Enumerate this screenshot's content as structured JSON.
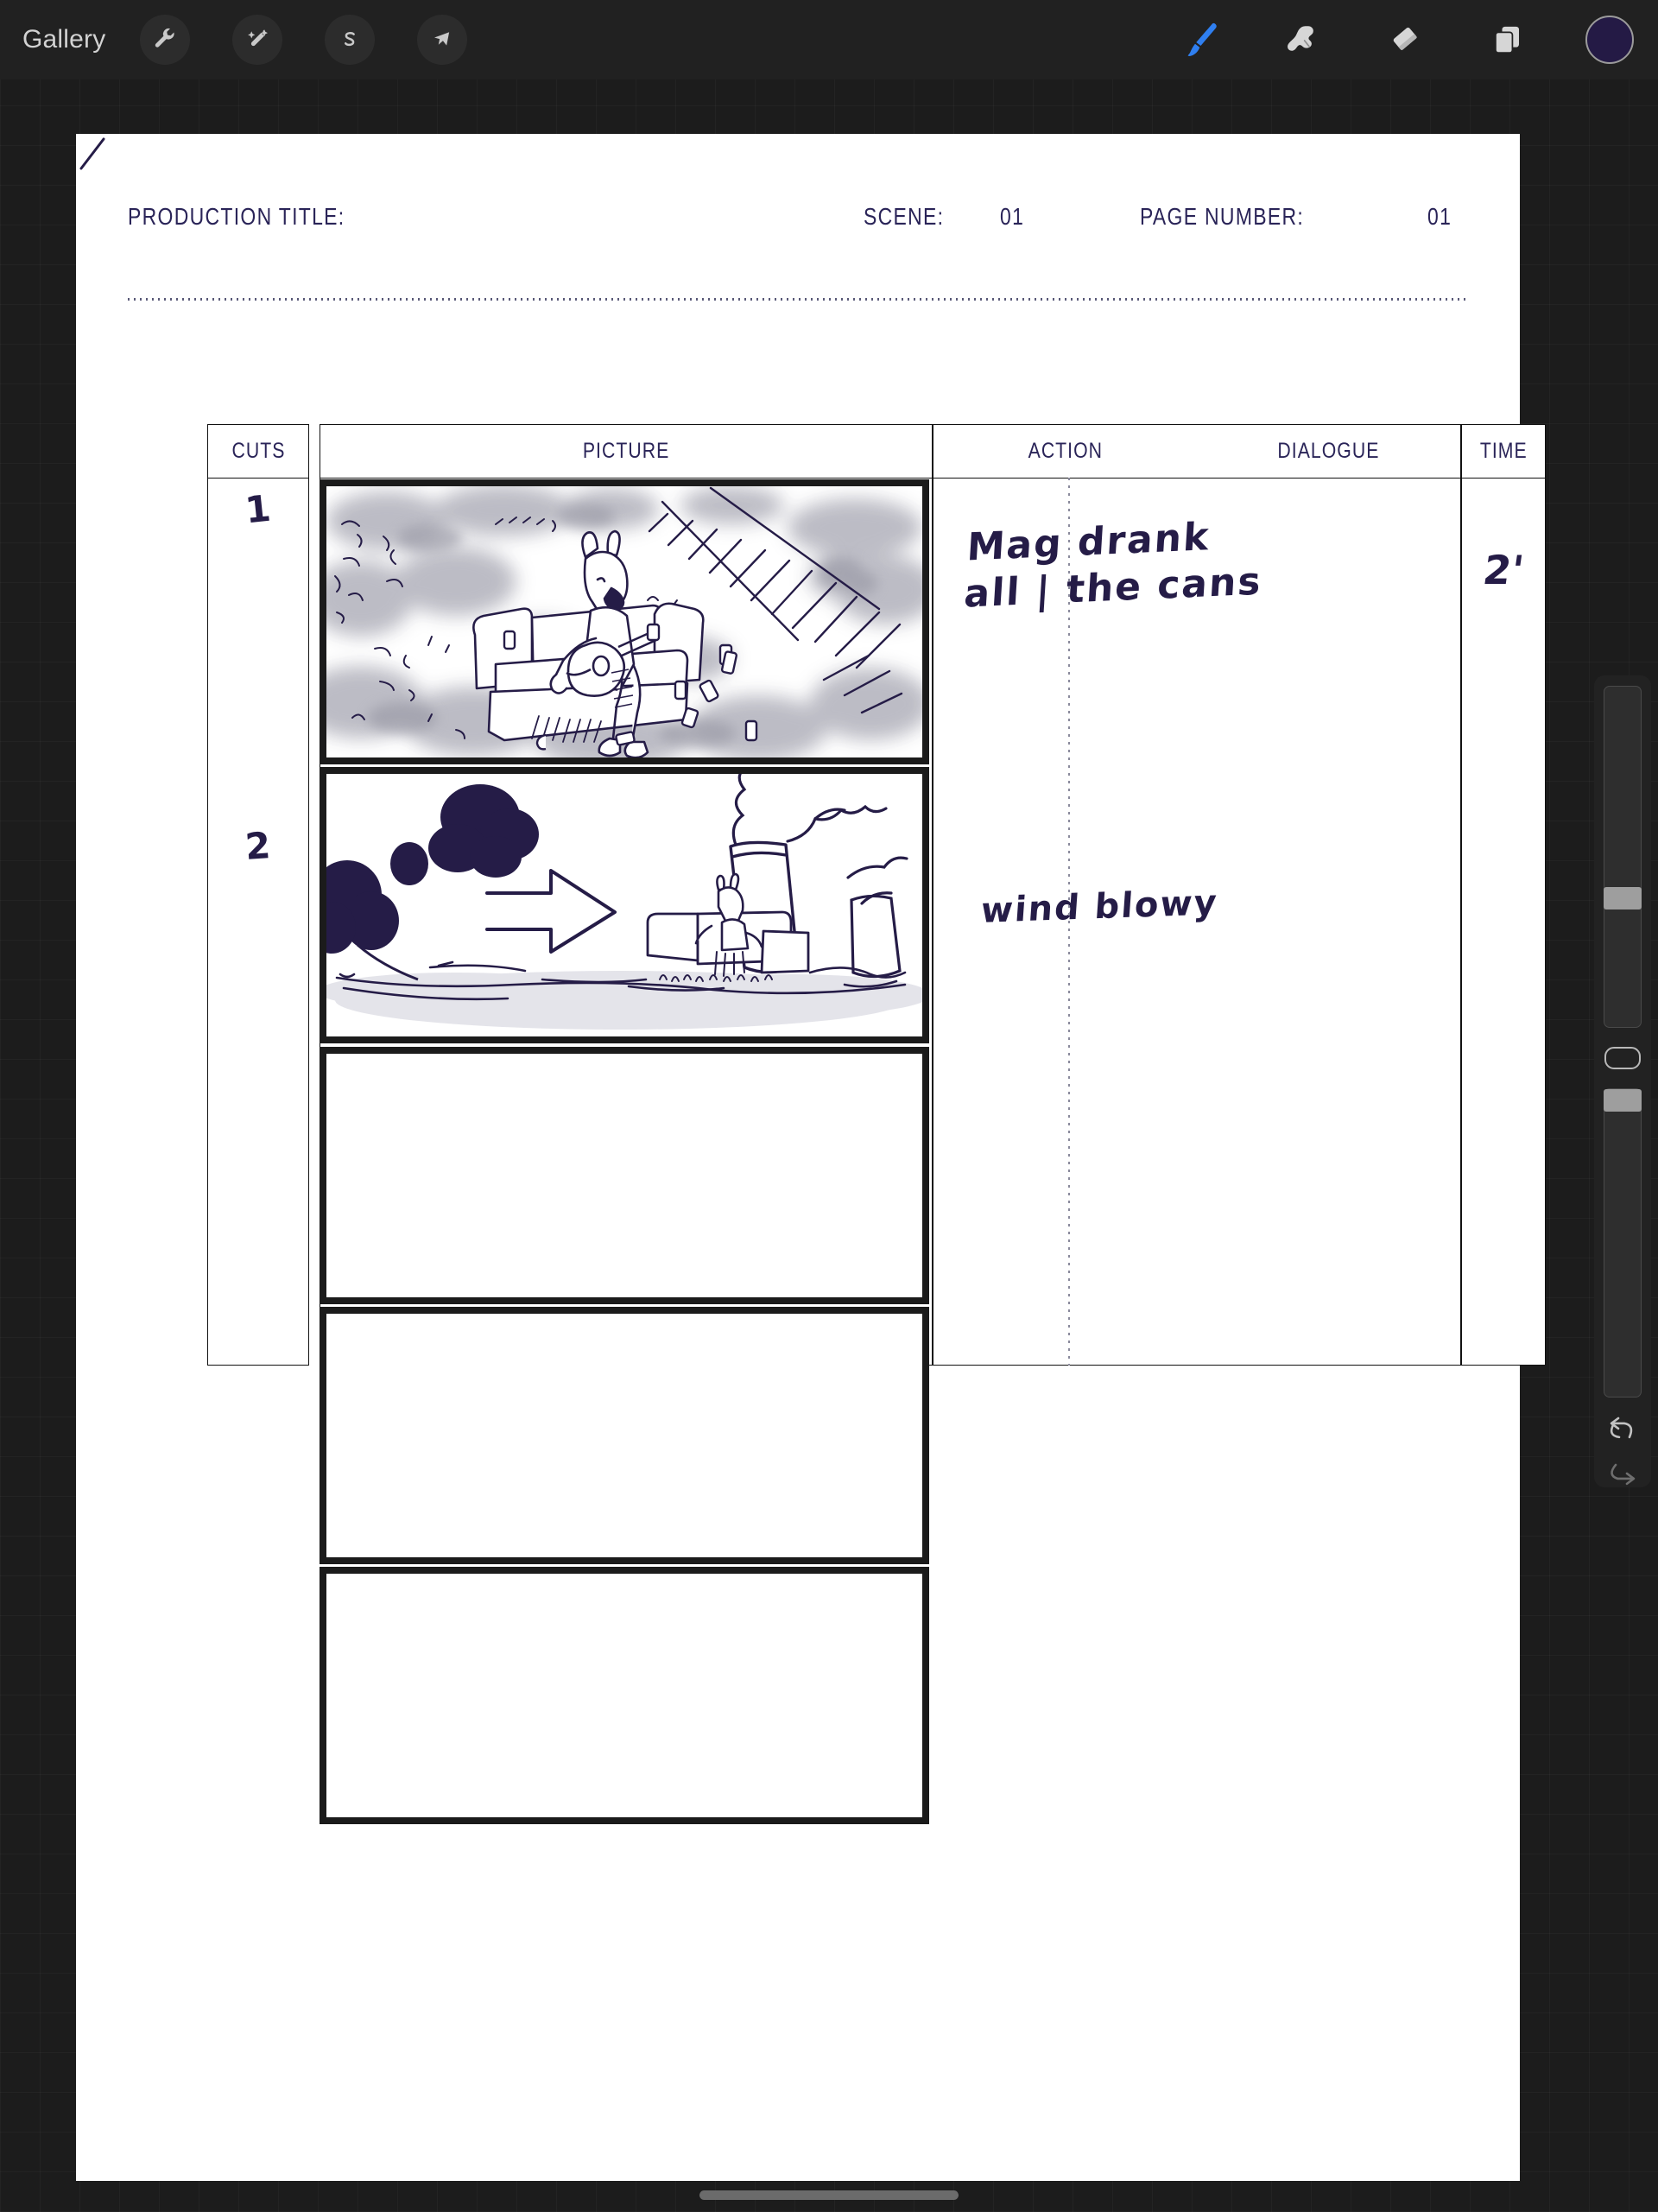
{
  "app": {
    "name": "Procreate",
    "background_color": "#1c1c1c",
    "paper_color": "#ffffff",
    "ink_color": "#251c47"
  },
  "topbar": {
    "gallery_label": "Gallery",
    "left_tools": [
      {
        "name": "actions-wrench-icon",
        "label": "Actions"
      },
      {
        "name": "adjustments-wand-icon",
        "label": "Adjustments"
      },
      {
        "name": "selection-s-icon",
        "label": "Selection"
      },
      {
        "name": "transform-arrow-icon",
        "label": "Transform"
      }
    ],
    "right_tools": [
      {
        "name": "paint-brush-icon",
        "label": "Paint",
        "active": true,
        "color": "#2f7ff0"
      },
      {
        "name": "smudge-icon",
        "label": "Smudge",
        "active": false,
        "color": "#d6d6d6"
      },
      {
        "name": "eraser-icon",
        "label": "Erase",
        "active": false,
        "color": "#d6d6d6"
      },
      {
        "name": "layers-icon",
        "label": "Layers",
        "active": false,
        "color": "#d6d6d6"
      }
    ],
    "color_swatch": "#241a45"
  },
  "storyboard": {
    "header": {
      "production_title_label": "PRODUCTION TITLE:",
      "production_title_value": "",
      "scene_label": "SCENE:",
      "scene_value": "01",
      "page_number_label": "PAGE NUMBER:",
      "page_number_value": "01"
    },
    "columns": [
      {
        "key": "cuts",
        "label": "CUTS"
      },
      {
        "key": "picture",
        "label": "PICTURE"
      },
      {
        "key": "action",
        "label": "ACTION"
      },
      {
        "key": "dialogue",
        "label": "DIALOGUE"
      },
      {
        "key": "time",
        "label": "TIME"
      }
    ],
    "rows": [
      {
        "cut": "1",
        "picture_description": "Donkey character sitting on a couch playing an acoustic guitar, surrounded by scattered cans, grey smoky wash background with diagonal hatched road",
        "action": "Mag drank\nall | the cans",
        "dialogue": "/",
        "time": "2'"
      },
      {
        "cut": "2",
        "picture_description": "Wide landscape: silhouetted trees at left, large outline arrow pointing right, donkey on couch beside cooling tower and smoke plume, ground wash",
        "action": "wind blowy",
        "dialogue": "",
        "time": ""
      },
      {
        "cut": "",
        "picture_description": "empty panel",
        "action": "",
        "dialogue": "",
        "time": ""
      },
      {
        "cut": "",
        "picture_description": "empty panel",
        "action": "",
        "dialogue": "",
        "time": ""
      },
      {
        "cut": "",
        "picture_description": "empty panel",
        "action": "",
        "dialogue": "",
        "time": ""
      }
    ]
  },
  "sidebar": {
    "brush_size": {
      "name": "brush-size-slider",
      "value_percent": 60
    },
    "modify_button": {
      "name": "modify-button",
      "label": ""
    },
    "brush_opacity": {
      "name": "brush-opacity-slider",
      "value_percent": 100
    },
    "undo": {
      "name": "undo-button",
      "label": "Undo"
    },
    "redo": {
      "name": "redo-button",
      "label": "Redo"
    }
  }
}
